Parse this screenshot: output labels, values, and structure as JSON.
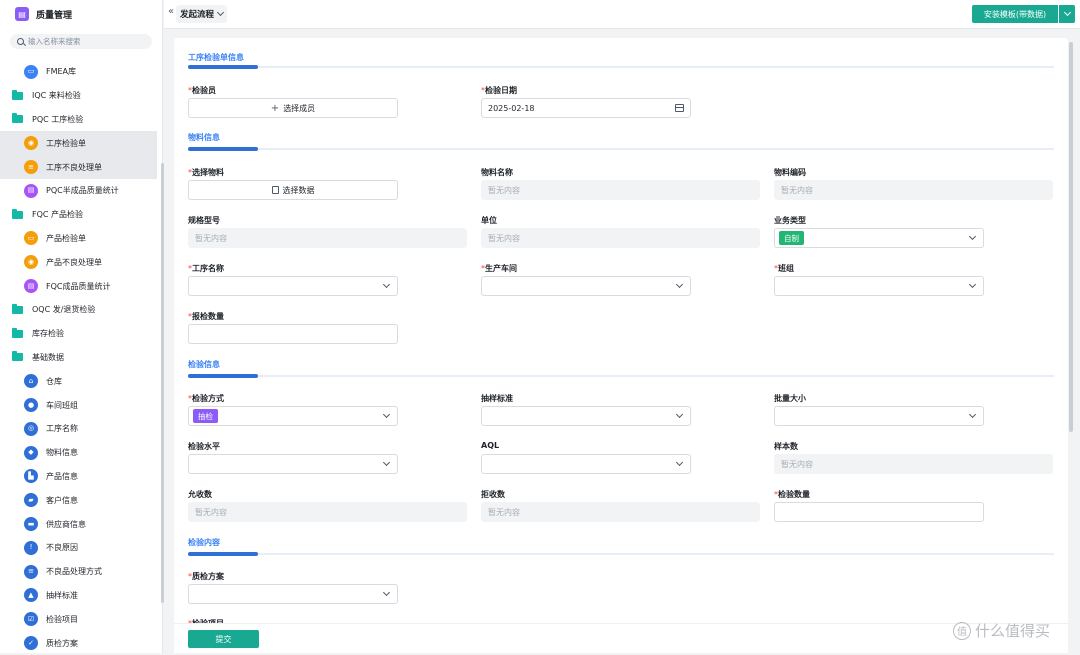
{
  "app": {
    "title": "质量管理",
    "logo_glyph": "▤"
  },
  "sidebar": {
    "search_placeholder": "输入名称来搜索",
    "items": [
      {
        "label": "FMEA库",
        "type": "leaf",
        "icon": "table-icon",
        "color": "#3b82f6",
        "glyph": "▭"
      },
      {
        "label": "IQC 来料检验",
        "type": "folder"
      },
      {
        "label": "PQC 工序检验",
        "type": "folder"
      },
      {
        "label": "工序检验单",
        "type": "leaf",
        "icon": "record-icon",
        "color": "#f59e0b",
        "glyph": "◉",
        "active": true
      },
      {
        "label": "工序不良处理单",
        "type": "leaf",
        "icon": "list-icon",
        "color": "#f59e0b",
        "glyph": "≡",
        "active": true
      },
      {
        "label": "PQC半成品质量统计",
        "type": "leaf",
        "icon": "stats-icon",
        "color": "#a855f7",
        "glyph": "▤"
      },
      {
        "label": "FQC 产品检验",
        "type": "folder"
      },
      {
        "label": "产品检验单",
        "type": "leaf",
        "icon": "form-icon",
        "color": "#f59e0b",
        "glyph": "▭"
      },
      {
        "label": "产品不良处理单",
        "type": "leaf",
        "icon": "record-icon",
        "color": "#f59e0b",
        "glyph": "◉"
      },
      {
        "label": "FQC成品质量统计",
        "type": "leaf",
        "icon": "stats-icon",
        "color": "#a855f7",
        "glyph": "▤"
      },
      {
        "label": "OQC 发/退货检验",
        "type": "folder"
      },
      {
        "label": "库存检验",
        "type": "folder"
      },
      {
        "label": "基础数据",
        "type": "folder"
      },
      {
        "label": "仓库",
        "type": "leaf",
        "icon": "home-icon",
        "color": "#2f6fd6",
        "glyph": "⌂"
      },
      {
        "label": "车间班组",
        "type": "leaf",
        "icon": "user-icon",
        "color": "#2f6fd6",
        "glyph": "●"
      },
      {
        "label": "工序名称",
        "type": "leaf",
        "icon": "target-icon",
        "color": "#2f6fd6",
        "glyph": "◎"
      },
      {
        "label": "物料信息",
        "type": "leaf",
        "icon": "box-icon",
        "color": "#2f6fd6",
        "glyph": "◆"
      },
      {
        "label": "产品信息",
        "type": "leaf",
        "icon": "factory-icon",
        "color": "#2f6fd6",
        "glyph": "▙"
      },
      {
        "label": "客户信息",
        "type": "leaf",
        "icon": "cart-icon",
        "color": "#2f6fd6",
        "glyph": "▰"
      },
      {
        "label": "供应商信息",
        "type": "leaf",
        "icon": "truck-icon",
        "color": "#2f6fd6",
        "glyph": "▬"
      },
      {
        "label": "不良原因",
        "type": "leaf",
        "icon": "warning-icon",
        "color": "#2f6fd6",
        "glyph": "!"
      },
      {
        "label": "不良品处理方式",
        "type": "leaf",
        "icon": "list-icon",
        "color": "#2f6fd6",
        "glyph": "≡"
      },
      {
        "label": "抽样标准",
        "type": "leaf",
        "icon": "sample-icon",
        "color": "#2f6fd6",
        "glyph": "▲"
      },
      {
        "label": "检验项目",
        "type": "leaf",
        "icon": "checklist-icon",
        "color": "#2f6fd6",
        "glyph": "☑"
      },
      {
        "label": "质检方案",
        "type": "leaf",
        "icon": "shield-icon",
        "color": "#2f6fd6",
        "glyph": "✓"
      }
    ]
  },
  "topbar": {
    "collapse_glyph": "«",
    "flow_title": "发起流程",
    "install_label": "安装模板(带数据)"
  },
  "form": {
    "section_work": "工序检验单信息",
    "inspector_label": "检验员",
    "inspector_button": "选择成员",
    "date_label": "检验日期",
    "date_value": "2025-02-18",
    "section_material": "物料信息",
    "select_material_label": "选择物料",
    "select_material_button": "选择数据",
    "material_name_label": "物料名称",
    "material_code_label": "物料编码",
    "spec_label": "规格型号",
    "unit_label": "单位",
    "biz_type_label": "业务类型",
    "biz_type_value": "自制",
    "biz_type_color": "#22b573",
    "process_name_label": "工序名称",
    "workshop_label": "生产车间",
    "team_label": "班组",
    "report_qty_label": "报检数量",
    "section_inspect": "检验信息",
    "method_label": "检验方式",
    "method_value": "抽检",
    "method_color": "#8b5cf6",
    "sampling_std_label": "抽样标准",
    "batch_size_label": "批量大小",
    "level_label": "检验水平",
    "aql_label": "AQL",
    "sample_qty_label": "样本数",
    "accept_label": "允收数",
    "reject_label": "拒收数",
    "inspect_qty_label": "检验数量",
    "section_content": "检验内容",
    "plan_label": "质检方案",
    "item_label": "检验项目",
    "empty": "暂无内容",
    "submit": "提交"
  },
  "watermark": {
    "glyph": "值",
    "text": "什么值得买"
  }
}
